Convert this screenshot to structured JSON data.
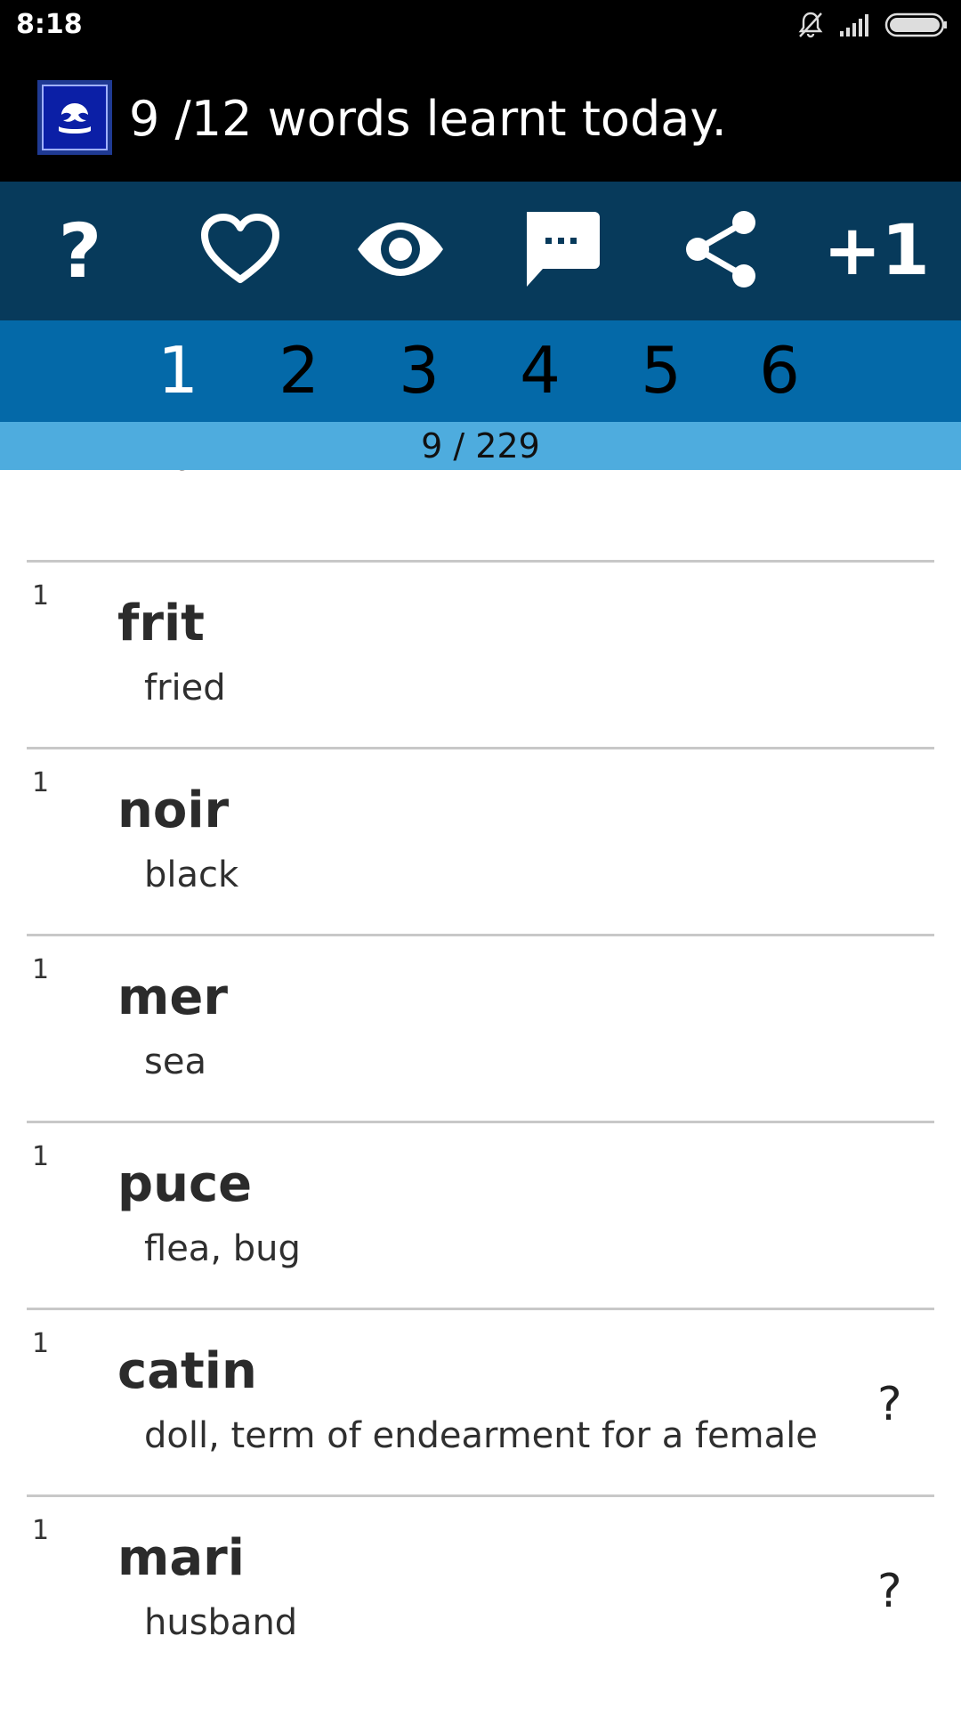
{
  "status_bar": {
    "time": "8:18",
    "icons": [
      "bell-muted-icon",
      "signal-icon",
      "battery-icon"
    ]
  },
  "app_bar": {
    "title": "9 /12 words learnt today.",
    "logo": "louisiana-flag-logo"
  },
  "toolbar": {
    "items": [
      {
        "name": "help-icon",
        "label": "?"
      },
      {
        "name": "heart-icon",
        "label": ""
      },
      {
        "name": "eye-icon",
        "label": ""
      },
      {
        "name": "chat-icon",
        "label": ""
      },
      {
        "name": "share-icon",
        "label": ""
      },
      {
        "name": "plus-one-button",
        "label": "+1"
      }
    ],
    "background": "#073a5b"
  },
  "tabs": {
    "items": [
      "1",
      "2",
      "3",
      "4",
      "5",
      "6"
    ],
    "selected": "1",
    "background": "#0469a8"
  },
  "progress": {
    "text": "9 / 229",
    "background": "#4eacde"
  },
  "list": {
    "partial_meaning": "wall",
    "rows": [
      {
        "count": "1",
        "word": "frit",
        "meaning": "fried",
        "mark": ""
      },
      {
        "count": "1",
        "word": "noir",
        "meaning": "black",
        "mark": ""
      },
      {
        "count": "1",
        "word": "mer",
        "meaning": "sea",
        "mark": ""
      },
      {
        "count": "1",
        "word": "puce",
        "meaning": "flea, bug",
        "mark": ""
      },
      {
        "count": "1",
        "word": "catin",
        "meaning": "doll, term of endearment for a female",
        "mark": "?"
      },
      {
        "count": "1",
        "word": "mari",
        "meaning": "husband",
        "mark": "?"
      }
    ]
  }
}
